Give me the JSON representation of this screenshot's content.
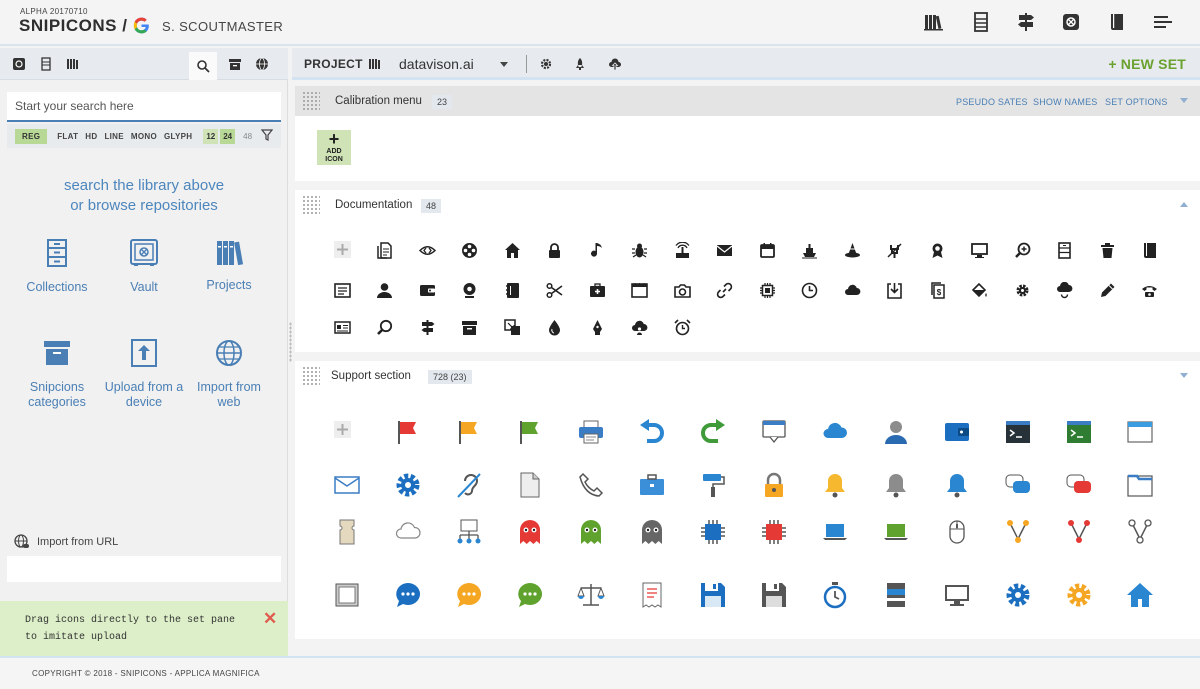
{
  "header": {
    "version": "ALPHA 20170710",
    "brand": "SNIPICONS /",
    "user": "S. SCOUTMASTER",
    "toolbar_icons": [
      "library-icon",
      "list-icon",
      "signpost-icon",
      "vault-icon",
      "book-icon",
      "menu-icon"
    ]
  },
  "left_panel": {
    "tabs": [
      "vault-icon",
      "list-icon",
      "library-icon",
      "search-icon",
      "archive-icon",
      "globe-icon"
    ],
    "search": {
      "placeholder": "Start your search here",
      "value": ""
    },
    "filters": [
      "REG",
      "FLAT",
      "HD",
      "LINE",
      "MONO",
      "GLYPH"
    ],
    "active_filter": "REG",
    "sizes": [
      "12",
      "24",
      "48"
    ],
    "hint": [
      "search the library above",
      "or browse repositories"
    ],
    "repos": [
      {
        "label": "Collections",
        "icon": "collections-icon"
      },
      {
        "label": "Vault",
        "icon": "vault-icon"
      },
      {
        "label": "Projects",
        "icon": "projects-icon"
      },
      {
        "label": "Snipcions categories",
        "icon": "categories-icon"
      },
      {
        "label": "Upload  from a device",
        "icon": "upload-icon"
      },
      {
        "label": "Import from web",
        "icon": "globe-icon"
      }
    ],
    "import_url": "Import from URL",
    "upload_message": [
      "Drag icons directly to the set pane",
      "to imitate upload"
    ]
  },
  "project": {
    "label": "PROJECT",
    "name": "datavison.ai",
    "new_set": "+ NEW SET"
  },
  "sets": [
    {
      "title": "Calibration menu",
      "count": "23",
      "links": [
        "PSEUDO SATES",
        "SHOW NAMES",
        "SET OPTIONS"
      ],
      "add_label": [
        "ADD",
        "ICON"
      ]
    },
    {
      "title": "Documentation",
      "count": "48"
    },
    {
      "title": "Support section",
      "count": "728 (23)"
    }
  ],
  "footer": "COPYRIGHT © 2018 - SNIPICONS  - APPLICA MAGNIFICA",
  "colors": {
    "accent": "#4a7fb5",
    "green": "#6aa12f",
    "highlight": "#b8d896"
  }
}
